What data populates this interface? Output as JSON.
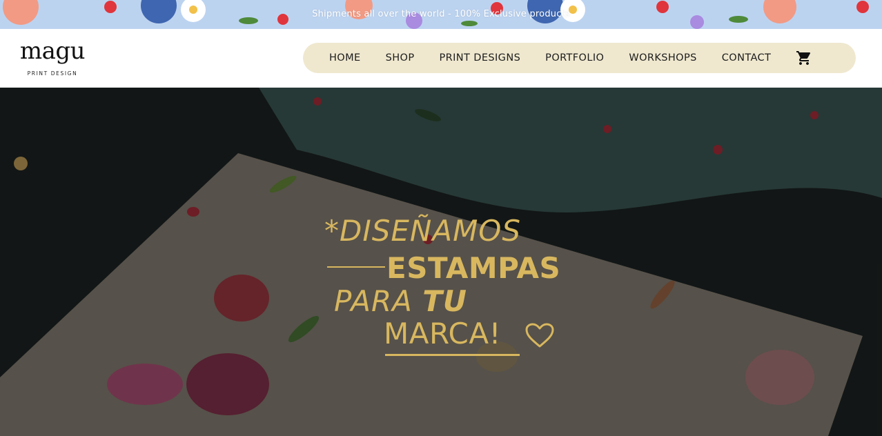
{
  "announcement": {
    "text": "Shipments all over the world - 100% Exclusive products"
  },
  "logo": {
    "word": "magu",
    "subtitle": "PRINT DESIGN"
  },
  "nav": {
    "items": [
      {
        "label": "HOME"
      },
      {
        "label": "SHOP"
      },
      {
        "label": "PRINT DESIGNS"
      },
      {
        "label": "PORTFOLIO"
      },
      {
        "label": "WORKSHOPS"
      },
      {
        "label": "CONTACT"
      }
    ],
    "cart_icon": "shopping-cart-icon"
  },
  "hero": {
    "line1": "*DISEÑAMOS",
    "line2": "ESTAMPAS",
    "line3_prefix": "PARA ",
    "line3_emphasis": "TU",
    "line4": "MARCA!",
    "heart_icon": "heart-outline-icon"
  },
  "colors": {
    "gold": "#d8b75f",
    "nav_pill": "#efe8cf",
    "announce_bg": "#bcd3f0",
    "hero_bg": "#1d2222"
  }
}
